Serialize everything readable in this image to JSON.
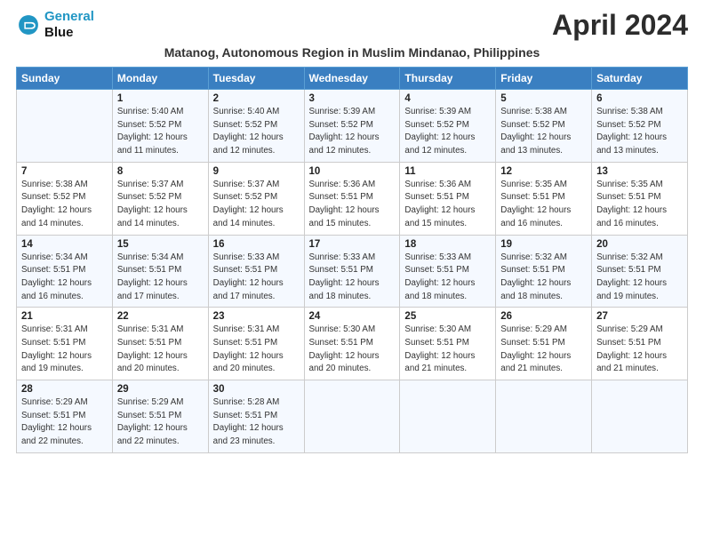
{
  "logo": {
    "line1": "General",
    "line2": "Blue"
  },
  "title": "April 2024",
  "subtitle": "Matanog, Autonomous Region in Muslim Mindanao, Philippines",
  "headers": [
    "Sunday",
    "Monday",
    "Tuesday",
    "Wednesday",
    "Thursday",
    "Friday",
    "Saturday"
  ],
  "weeks": [
    [
      {
        "day": "",
        "info": ""
      },
      {
        "day": "1",
        "info": "Sunrise: 5:40 AM\nSunset: 5:52 PM\nDaylight: 12 hours\nand 11 minutes."
      },
      {
        "day": "2",
        "info": "Sunrise: 5:40 AM\nSunset: 5:52 PM\nDaylight: 12 hours\nand 12 minutes."
      },
      {
        "day": "3",
        "info": "Sunrise: 5:39 AM\nSunset: 5:52 PM\nDaylight: 12 hours\nand 12 minutes."
      },
      {
        "day": "4",
        "info": "Sunrise: 5:39 AM\nSunset: 5:52 PM\nDaylight: 12 hours\nand 12 minutes."
      },
      {
        "day": "5",
        "info": "Sunrise: 5:38 AM\nSunset: 5:52 PM\nDaylight: 12 hours\nand 13 minutes."
      },
      {
        "day": "6",
        "info": "Sunrise: 5:38 AM\nSunset: 5:52 PM\nDaylight: 12 hours\nand 13 minutes."
      }
    ],
    [
      {
        "day": "7",
        "info": "Sunrise: 5:38 AM\nSunset: 5:52 PM\nDaylight: 12 hours\nand 14 minutes."
      },
      {
        "day": "8",
        "info": "Sunrise: 5:37 AM\nSunset: 5:52 PM\nDaylight: 12 hours\nand 14 minutes."
      },
      {
        "day": "9",
        "info": "Sunrise: 5:37 AM\nSunset: 5:52 PM\nDaylight: 12 hours\nand 14 minutes."
      },
      {
        "day": "10",
        "info": "Sunrise: 5:36 AM\nSunset: 5:51 PM\nDaylight: 12 hours\nand 15 minutes."
      },
      {
        "day": "11",
        "info": "Sunrise: 5:36 AM\nSunset: 5:51 PM\nDaylight: 12 hours\nand 15 minutes."
      },
      {
        "day": "12",
        "info": "Sunrise: 5:35 AM\nSunset: 5:51 PM\nDaylight: 12 hours\nand 16 minutes."
      },
      {
        "day": "13",
        "info": "Sunrise: 5:35 AM\nSunset: 5:51 PM\nDaylight: 12 hours\nand 16 minutes."
      }
    ],
    [
      {
        "day": "14",
        "info": "Sunrise: 5:34 AM\nSunset: 5:51 PM\nDaylight: 12 hours\nand 16 minutes."
      },
      {
        "day": "15",
        "info": "Sunrise: 5:34 AM\nSunset: 5:51 PM\nDaylight: 12 hours\nand 17 minutes."
      },
      {
        "day": "16",
        "info": "Sunrise: 5:33 AM\nSunset: 5:51 PM\nDaylight: 12 hours\nand 17 minutes."
      },
      {
        "day": "17",
        "info": "Sunrise: 5:33 AM\nSunset: 5:51 PM\nDaylight: 12 hours\nand 18 minutes."
      },
      {
        "day": "18",
        "info": "Sunrise: 5:33 AM\nSunset: 5:51 PM\nDaylight: 12 hours\nand 18 minutes."
      },
      {
        "day": "19",
        "info": "Sunrise: 5:32 AM\nSunset: 5:51 PM\nDaylight: 12 hours\nand 18 minutes."
      },
      {
        "day": "20",
        "info": "Sunrise: 5:32 AM\nSunset: 5:51 PM\nDaylight: 12 hours\nand 19 minutes."
      }
    ],
    [
      {
        "day": "21",
        "info": "Sunrise: 5:31 AM\nSunset: 5:51 PM\nDaylight: 12 hours\nand 19 minutes."
      },
      {
        "day": "22",
        "info": "Sunrise: 5:31 AM\nSunset: 5:51 PM\nDaylight: 12 hours\nand 20 minutes."
      },
      {
        "day": "23",
        "info": "Sunrise: 5:31 AM\nSunset: 5:51 PM\nDaylight: 12 hours\nand 20 minutes."
      },
      {
        "day": "24",
        "info": "Sunrise: 5:30 AM\nSunset: 5:51 PM\nDaylight: 12 hours\nand 20 minutes."
      },
      {
        "day": "25",
        "info": "Sunrise: 5:30 AM\nSunset: 5:51 PM\nDaylight: 12 hours\nand 21 minutes."
      },
      {
        "day": "26",
        "info": "Sunrise: 5:29 AM\nSunset: 5:51 PM\nDaylight: 12 hours\nand 21 minutes."
      },
      {
        "day": "27",
        "info": "Sunrise: 5:29 AM\nSunset: 5:51 PM\nDaylight: 12 hours\nand 21 minutes."
      }
    ],
    [
      {
        "day": "28",
        "info": "Sunrise: 5:29 AM\nSunset: 5:51 PM\nDaylight: 12 hours\nand 22 minutes."
      },
      {
        "day": "29",
        "info": "Sunrise: 5:29 AM\nSunset: 5:51 PM\nDaylight: 12 hours\nand 22 minutes."
      },
      {
        "day": "30",
        "info": "Sunrise: 5:28 AM\nSunset: 5:51 PM\nDaylight: 12 hours\nand 23 minutes."
      },
      {
        "day": "",
        "info": ""
      },
      {
        "day": "",
        "info": ""
      },
      {
        "day": "",
        "info": ""
      },
      {
        "day": "",
        "info": ""
      }
    ]
  ]
}
